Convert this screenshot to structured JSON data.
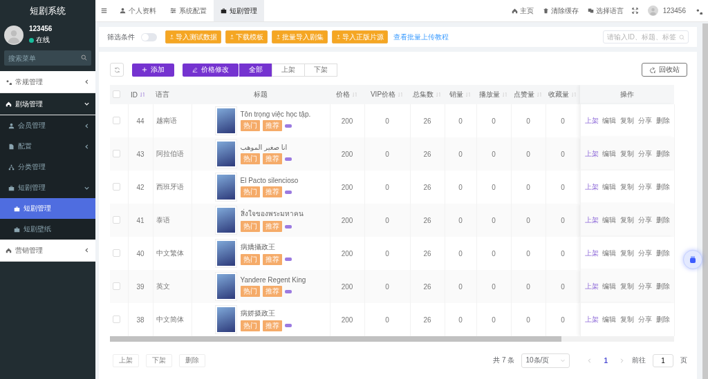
{
  "sidebar": {
    "title": "短剧系统",
    "user": {
      "name": "123456",
      "status": "在线",
      "online": true
    },
    "search": {
      "placeholder": "搜索菜单"
    },
    "menu": [
      {
        "label": "常规管理",
        "expanded": false
      },
      {
        "label": "剧场管理",
        "expanded": true,
        "children": [
          {
            "label": "会员管理",
            "expanded": false
          },
          {
            "label": "配置",
            "expanded": false
          },
          {
            "label": "分类管理"
          },
          {
            "label": "短剧管理",
            "expanded": true,
            "children": [
              {
                "label": "短剧管理",
                "selected": true
              },
              {
                "label": "短剧壁纸",
                "selected": false
              }
            ]
          }
        ]
      },
      {
        "label": "营销管理",
        "expanded": false
      }
    ]
  },
  "header": {
    "tabs": [
      {
        "label": "个人资料",
        "selected": false
      },
      {
        "label": "系统配置",
        "selected": false
      },
      {
        "label": "短剧管理",
        "selected": true
      }
    ],
    "links": [
      "主页",
      "清除缓存",
      "选择语言"
    ],
    "user": "123456"
  },
  "filter": {
    "label": "筛选条件",
    "on": false,
    "buttons": [
      "导入测试数据",
      "下载模板",
      "批量导入剧集",
      "导入正版片源"
    ],
    "link": "查看批量上传教程",
    "search": {
      "placeholder": "请输入ID、标题、标签"
    }
  },
  "actions": {
    "add": "添加",
    "price": "价格修改",
    "status_tabs": [
      {
        "label": "全部",
        "selected": true
      },
      {
        "label": "上架",
        "selected": false
      },
      {
        "label": "下架",
        "selected": false
      }
    ],
    "recycle": "回收站"
  },
  "table": {
    "all_checked": false,
    "columns": [
      {
        "label": "ID",
        "sortable": true
      },
      {
        "label": "语言",
        "sortable": false
      },
      {
        "label": "标题",
        "sortable": false
      },
      {
        "label": "价格",
        "sortable": true
      },
      {
        "label": "VIP价格",
        "sortable": true
      },
      {
        "label": "总集数",
        "sortable": true
      },
      {
        "label": "销量",
        "sortable": true
      },
      {
        "label": "播放量",
        "sortable": true
      },
      {
        "label": "点赞量",
        "sortable": true
      },
      {
        "label": "收藏量",
        "sortable": true
      },
      {
        "label": "操作",
        "sortable": false
      }
    ],
    "rows": [
      {
        "checked": false,
        "id": "44",
        "language": "越南语",
        "title": "Tôn trọng việc học tập.",
        "tags": [
          "热门",
          "推荐"
        ],
        "price": "200",
        "vip_price": "0",
        "episodes": "26",
        "sales": "0",
        "plays": "0",
        "likes": "0",
        "favorites": "0",
        "ops": [
          "上架",
          "编辑",
          "复制",
          "分享",
          "删除"
        ]
      },
      {
        "checked": false,
        "id": "43",
        "language": "阿拉伯语",
        "title": "انا صغير الموهب",
        "tags": [
          "热门",
          "推荐"
        ],
        "price": "200",
        "vip_price": "0",
        "episodes": "26",
        "sales": "0",
        "plays": "0",
        "likes": "0",
        "favorites": "0",
        "ops": [
          "上架",
          "编辑",
          "复制",
          "分享",
          "删除"
        ]
      },
      {
        "checked": false,
        "id": "42",
        "language": "西班牙语",
        "title": "El Pacto silencioso",
        "tags": [
          "热门",
          "推荐"
        ],
        "price": "200",
        "vip_price": "0",
        "episodes": "26",
        "sales": "0",
        "plays": "0",
        "likes": "0",
        "favorites": "0",
        "ops": [
          "上架",
          "编辑",
          "复制",
          "分享",
          "删除"
        ]
      },
      {
        "checked": false,
        "id": "41",
        "language": "泰语",
        "title": "สิ่งใจของพระมหาคน",
        "tags": [
          "热门",
          "推荐"
        ],
        "price": "200",
        "vip_price": "0",
        "episodes": "26",
        "sales": "0",
        "plays": "0",
        "likes": "0",
        "favorites": "0",
        "ops": [
          "上架",
          "编辑",
          "复制",
          "分享",
          "删除"
        ]
      },
      {
        "checked": false,
        "id": "40",
        "language": "中文繁体",
        "title": "病嬌攝政王",
        "tags": [
          "热门",
          "推荐"
        ],
        "price": "200",
        "vip_price": "0",
        "episodes": "26",
        "sales": "0",
        "plays": "0",
        "likes": "0",
        "favorites": "0",
        "ops": [
          "上架",
          "编辑",
          "复制",
          "分享",
          "删除"
        ]
      },
      {
        "checked": false,
        "id": "39",
        "language": "英文",
        "title": "Yandere Regent King",
        "tags": [
          "热门",
          "推荐"
        ],
        "price": "200",
        "vip_price": "0",
        "episodes": "26",
        "sales": "0",
        "plays": "0",
        "likes": "0",
        "favorites": "0",
        "ops": [
          "上架",
          "编辑",
          "复制",
          "分享",
          "删除"
        ]
      },
      {
        "checked": false,
        "id": "38",
        "language": "中文简体",
        "title": "病娇摄政王",
        "tags": [
          "热门",
          "推荐"
        ],
        "price": "200",
        "vip_price": "0",
        "episodes": "26",
        "sales": "0",
        "plays": "0",
        "likes": "0",
        "favorites": "0",
        "ops": [
          "上架",
          "编辑",
          "复制",
          "分享",
          "删除"
        ]
      }
    ]
  },
  "footer": {
    "buttons": [
      "上架",
      "下架",
      "删除"
    ],
    "total": "共 7 条",
    "page_size": "10条/页",
    "pages": [
      {
        "label": "1",
        "selected": true
      }
    ],
    "goto_label": "前往",
    "goto_value": "1",
    "goto_unit": "页"
  }
}
